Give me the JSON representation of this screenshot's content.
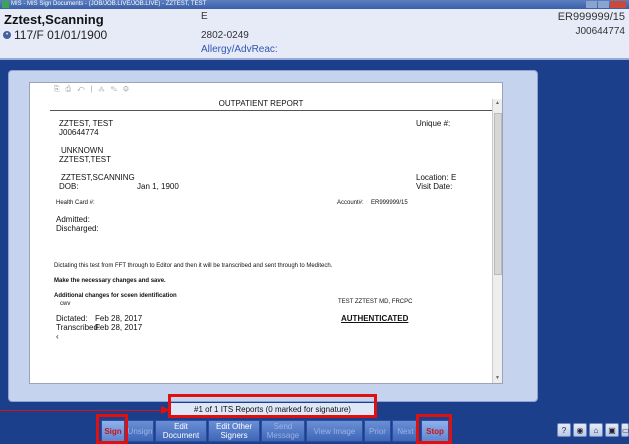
{
  "window": {
    "title": "MIS - MIS Sign Documents - (JOB/JOB.LIVE/JOB.LIVE) - ZZTEST, TEST"
  },
  "patient": {
    "name": "Zztest,Scanning",
    "sex_dob": "117/F  01/01/1900",
    "location": "E",
    "room": "2802-0249",
    "allergy_label": "Allergy/AdvReac:",
    "account": "ER999999/15",
    "unit_number": "J00644774"
  },
  "report": {
    "toolbar_icons": "⎘ ⎙ ↶ | ⁂ ✎ ⚙",
    "title": "OUTPATIENT REPORT",
    "patient_name": "ZZTEST, TEST",
    "unit_no": "J00644774",
    "unique_label": "Unique #:",
    "unknown": "UNKNOWN",
    "unknown_name": "ZZTEST,TEST",
    "scan_name": "ZZTEST,SCANNING",
    "location_label": "Location:",
    "location_value": "E",
    "dob_label": "DOB:",
    "dob_value": "Jan 1, 1900",
    "visit_label": "Visit Date:",
    "health_card_label": "Health Card #:",
    "account_label": "Account#:",
    "account_value": "ER999999/15",
    "admitted_label": "Admitted:",
    "discharged_label": "Discharged:",
    "dictation_text": "Dictating this test from FFT through to Editor and then it will be transcribed and sent through to Meditech.",
    "changes_text": "Make the necessary changes and save.",
    "additional_text": "Additional changes for sceen identification",
    "cc_text": "cwv",
    "signer": "TEST ZZTEST MD, FRCPC",
    "dictated_label": "Dictated:",
    "dictated_value": "Feb 28, 2017",
    "transcribed_label": "Transcribed:",
    "transcribed_value": "Feb 28, 2017",
    "status": "AUTHENTICATED",
    "bullet": "‹"
  },
  "status_bar": {
    "text": "#1 of 1  ITS Reports  (0 marked for signature)"
  },
  "buttons": {
    "sign": "Sign",
    "unsign": "Unsign",
    "edit_document": "Edit Document",
    "edit_other_signers": "Edit Other Signers",
    "send_message": "Send Message",
    "view_image": "View Image",
    "prior": "Prior",
    "next": "Next",
    "stop": "Stop"
  },
  "side_buttons": {
    "help": "?",
    "b2": "◉",
    "b3": "⌂",
    "b4": "▣",
    "b5": "▭"
  },
  "colors": {
    "background": "#1b3f8b",
    "highlight": "#e01010",
    "header": "#e7ebf8"
  }
}
